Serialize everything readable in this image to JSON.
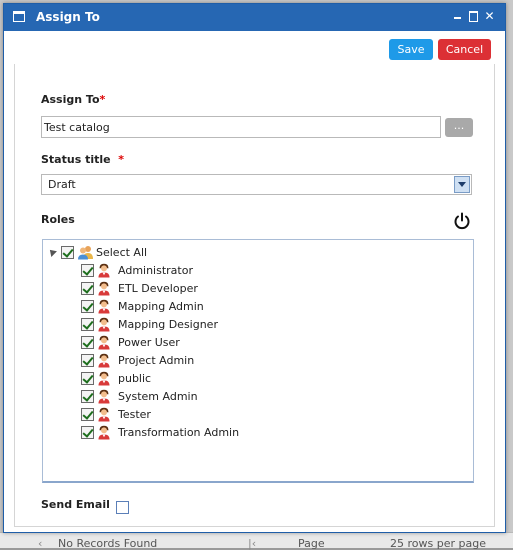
{
  "dialog": {
    "title": "Assign To",
    "window_controls": [
      "_",
      "□",
      "✕"
    ]
  },
  "toolbar": {
    "save_label": "Save",
    "cancel_label": "Cancel"
  },
  "form": {
    "assign_to": {
      "label": "Assign To",
      "required_mark": "*",
      "value": "Test catalog",
      "browse_label": "..."
    },
    "status_title": {
      "label": "Status title",
      "required_mark": "*",
      "selected": "Draft"
    },
    "roles": {
      "label": "Roles",
      "select_all_label": "Select All",
      "items": [
        {
          "label": "Administrator",
          "checked": true
        },
        {
          "label": "ETL Developer",
          "checked": true
        },
        {
          "label": "Mapping Admin",
          "checked": true
        },
        {
          "label": "Mapping Designer",
          "checked": true
        },
        {
          "label": "Power User",
          "checked": true
        },
        {
          "label": "Project Admin",
          "checked": true
        },
        {
          "label": "public",
          "checked": true
        },
        {
          "label": "System Admin",
          "checked": true
        },
        {
          "label": "Tester",
          "checked": true
        },
        {
          "label": "Transformation Admin",
          "checked": true
        }
      ]
    },
    "send_email": {
      "label": "Send Email",
      "checked": false
    }
  },
  "background": {
    "records_text": "No Records Found",
    "page_label": "Page",
    "rows_per_page": "25 rows per page"
  },
  "colors": {
    "titlebar": "#2667b3",
    "save": "#1e9ae8",
    "cancel": "#dc3035",
    "required": "#dd0000"
  }
}
